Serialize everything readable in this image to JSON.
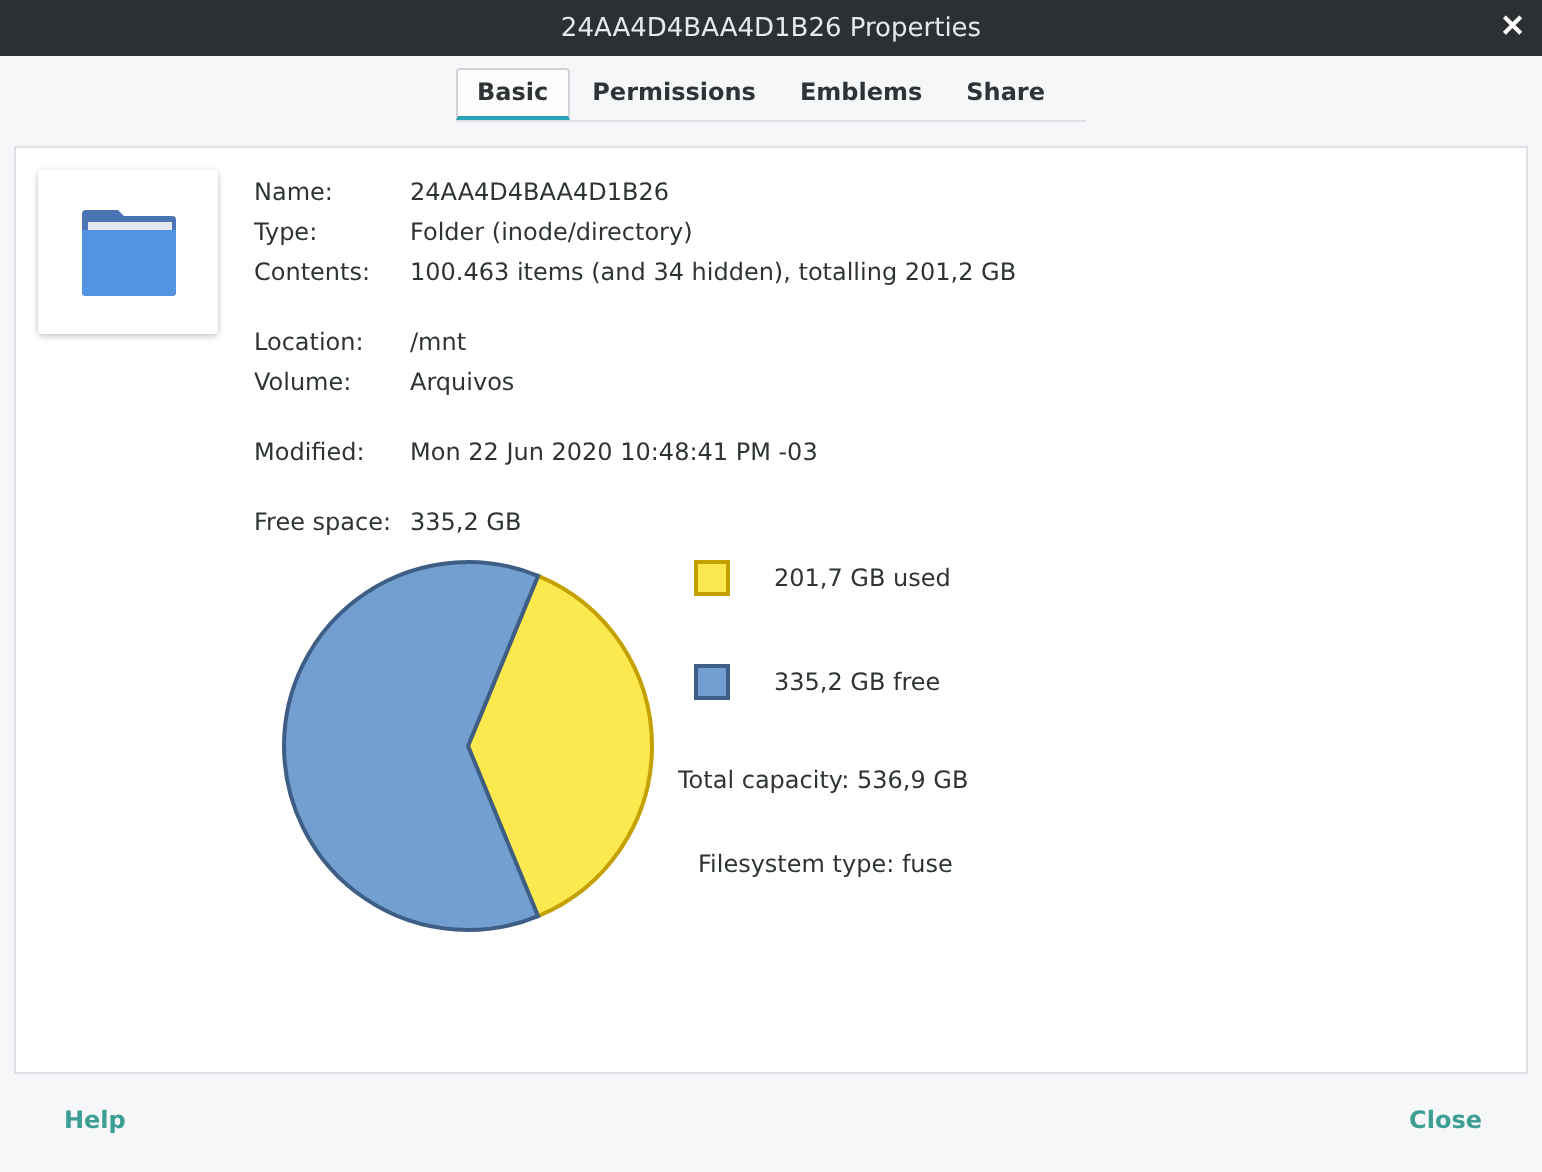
{
  "window": {
    "title": "24AA4D4BAA4D1B26 Properties",
    "close": "✕"
  },
  "tabs": [
    {
      "label": "Basic",
      "selected": true
    },
    {
      "label": "Permissions",
      "selected": false
    },
    {
      "label": "Emblems",
      "selected": false
    },
    {
      "label": "Share",
      "selected": false
    }
  ],
  "groups": [
    [
      {
        "label": "Name:",
        "value": "24AA4D4BAA4D1B26"
      },
      {
        "label": "Type:",
        "value": "Folder (inode/directory)"
      },
      {
        "label": "Contents:",
        "value": "100.463 items (and 34 hidden), totalling 201,2 GB"
      }
    ],
    [
      {
        "label": "Location:",
        "value": "/mnt"
      },
      {
        "label": "Volume:",
        "value": "Arquivos"
      }
    ],
    [
      {
        "label": "Modified:",
        "value": "Mon 22 Jun 2020 10:48:41 PM -03"
      }
    ],
    [
      {
        "label": "Free space:",
        "value": "335,2 GB"
      }
    ]
  ],
  "usage": {
    "chart_data": {
      "type": "pie",
      "categories": [
        "201,7 GB used",
        "335,2 GB free"
      ],
      "values": [
        201.7,
        335.2
      ],
      "colors": [
        "#fce94f",
        "#729fcf"
      ]
    },
    "total": "Total capacity: 536,9 GB",
    "filesystem": "Filesystem type: fuse"
  },
  "footer": {
    "help": "Help",
    "close": "Close"
  }
}
